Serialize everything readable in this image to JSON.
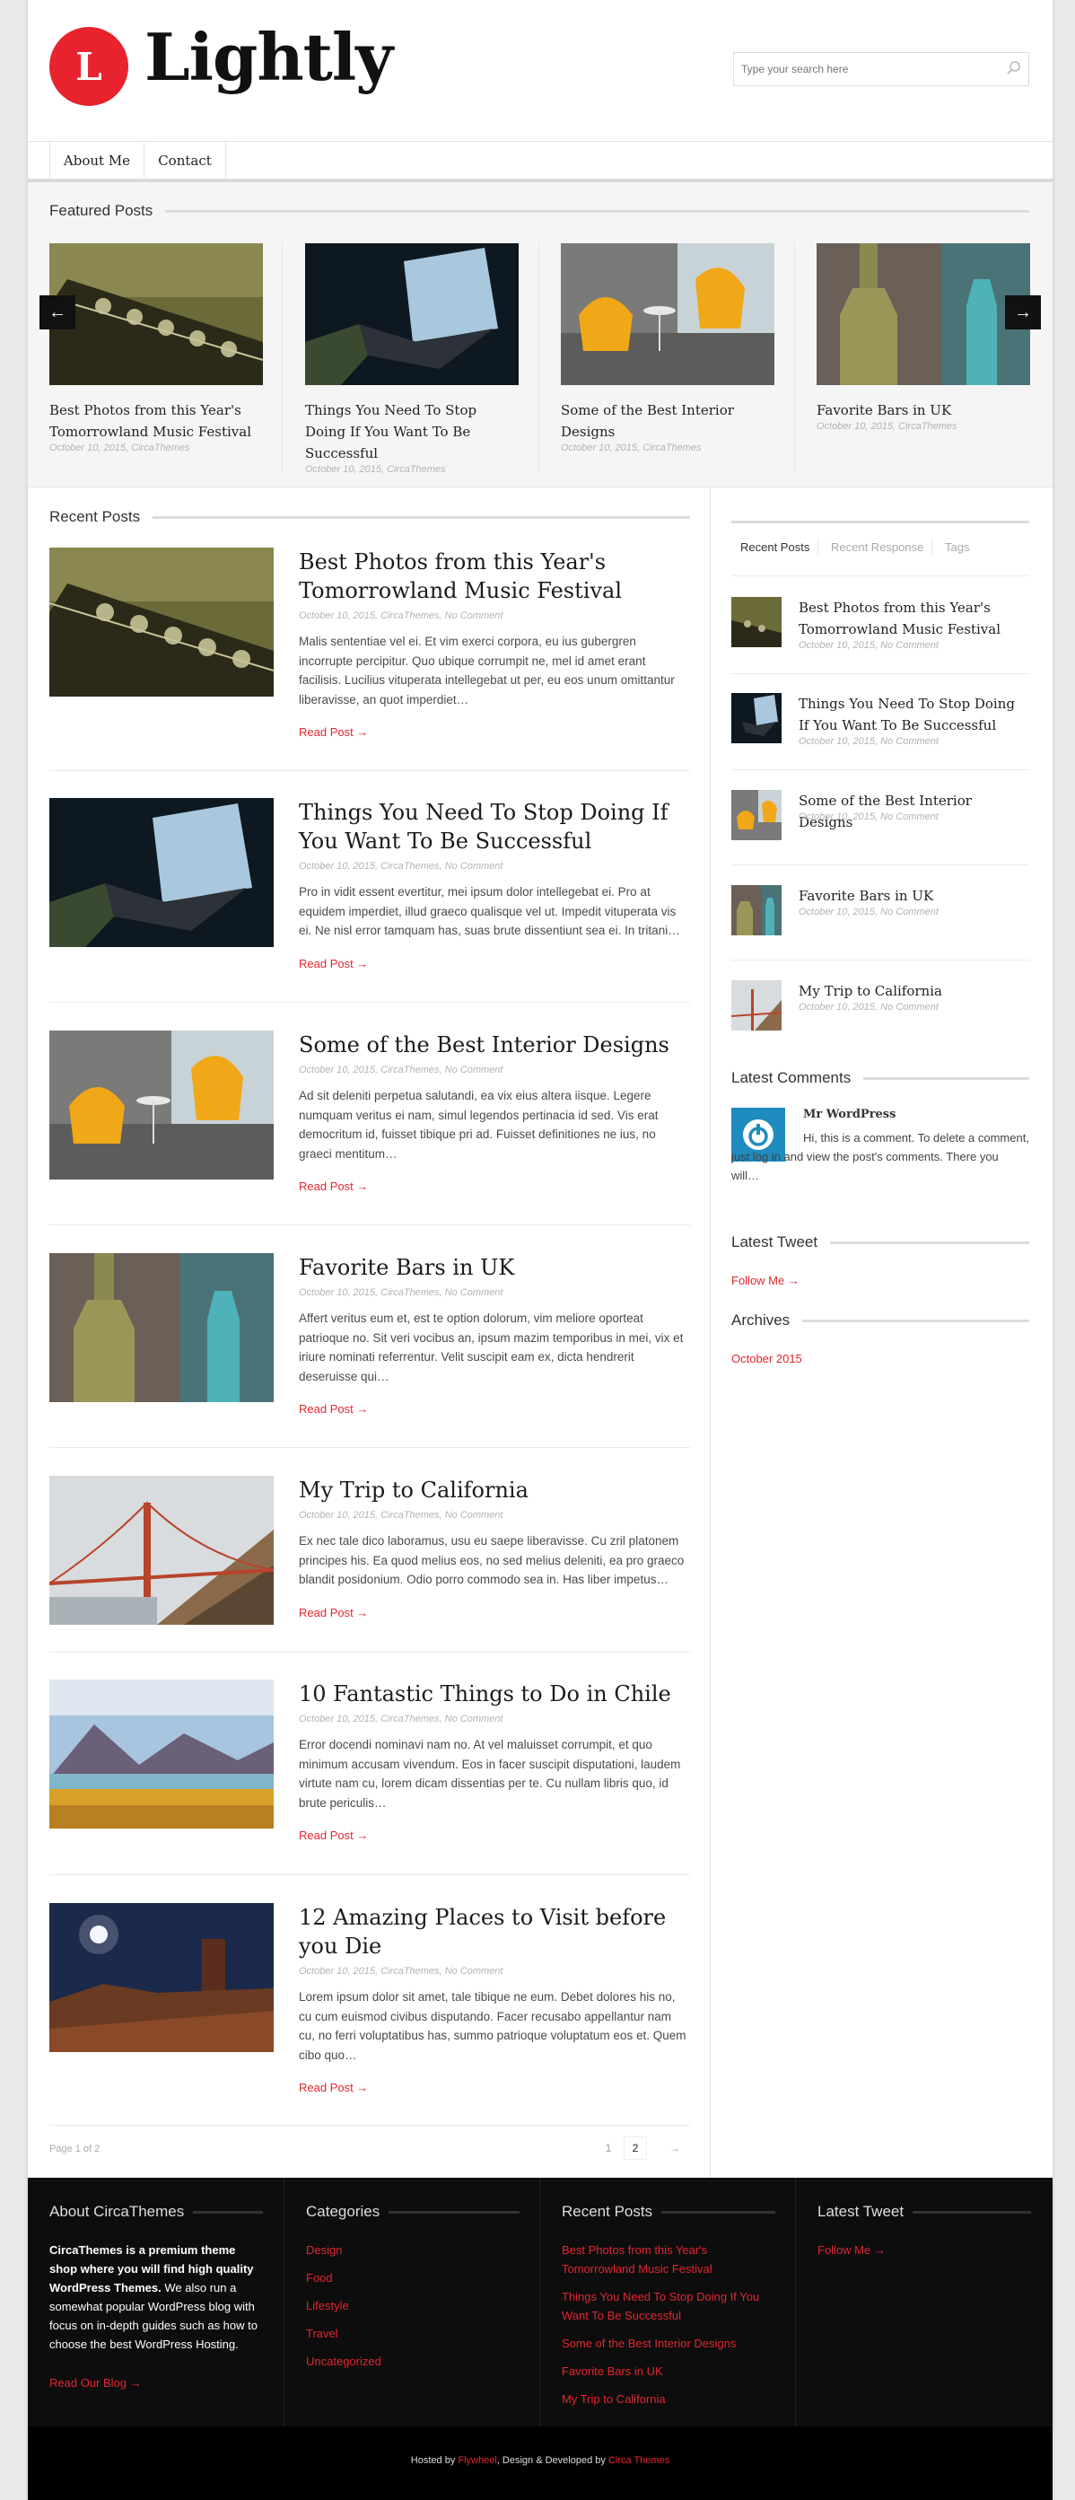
{
  "site": {
    "logo_letter": "L",
    "name": "Lightly",
    "accent": "#e8232e"
  },
  "search": {
    "placeholder": "Type your search here"
  },
  "nav": {
    "items": [
      "About Me",
      "Contact"
    ]
  },
  "featured": {
    "heading": "Featured Posts",
    "items": [
      {
        "title": "Best Photos from this Year's Tomorrowland Music Festival",
        "date": "October 10, 2015",
        "author": "CircaThemes"
      },
      {
        "title": "Things You Need To Stop Doing If You Want To Be Successful",
        "date": "October 10, 2015",
        "author": "CircaThemes"
      },
      {
        "title": "Some of the Best Interior Designs",
        "date": "October 10, 2015",
        "author": "CircaThemes"
      },
      {
        "title": "Favorite Bars in UK",
        "date": "October 10, 2015",
        "author": "CircaThemes"
      }
    ],
    "prev": "←",
    "next": "→"
  },
  "recent": {
    "heading": "Recent Posts",
    "posts": [
      {
        "title": "Best Photos from this Year's Tomorrowland Music Festival",
        "date": "October 10, 2015",
        "author": "CircaThemes",
        "comments": "No Comment",
        "excerpt": "Malis sententiae vel ei. Et vim exerci corpora, eu ius gubergren incorrupte percipitur. Quo ubique corrumpit ne, mel id amet erant facilisis. Lucilius vituperata intellegebat ut per, eu eos unum omittantur liberavisse, an quot imperdiet…",
        "read_more": "Read Post →"
      },
      {
        "title": "Things You Need To Stop Doing If You Want To Be Successful",
        "date": "October 10, 2015",
        "author": "CircaThemes",
        "comments": "No Comment",
        "excerpt": "Pro in vidit essent evertitur, mei ipsum dolor intellegebat ei. Pro at equidem imperdiet, illud graeco qualisque vel ut. Impedit vituperata vis ei. Ne nisl error tamquam has, suas brute dissentiunt sea ei. In tritani…",
        "read_more": "Read Post →"
      },
      {
        "title": "Some of the Best Interior Designs",
        "date": "October 10, 2015",
        "author": "CircaThemes",
        "comments": "No Comment",
        "excerpt": "Ad sit deleniti perpetua salutandi, ea vix eius altera iisque. Legere numquam veritus ei nam, simul legendos pertinacia id sed. Vis erat democritum id, fuisset tibique pri ad. Fuisset definitiones ne ius, no graeci mentitum…",
        "read_more": "Read Post →"
      },
      {
        "title": "Favorite Bars in UK",
        "date": "October 10, 2015",
        "author": "CircaThemes",
        "comments": "No Comment",
        "excerpt": "Affert veritus eum et, est te option dolorum, vim meliore oporteat patrioque no. Sit veri vocibus an, ipsum mazim temporibus in mei, vix et iriure nominati referrentur. Velit suscipit eam ex, dicta hendrerit deseruisse qui…",
        "read_more": "Read Post →"
      },
      {
        "title": "My Trip to California",
        "date": "October 10, 2015",
        "author": "CircaThemes",
        "comments": "No Comment",
        "excerpt": "Ex nec tale dico laboramus, usu eu saepe liberavisse. Cu zril platonem principes his. Ea quod melius eos, no sed melius deleniti, ea pro graeco blandit posidonium. Odio porro commodo sea in. Has liber impetus…",
        "read_more": "Read Post →"
      },
      {
        "title": "10 Fantastic Things to Do in Chile",
        "date": "October 10, 2015",
        "author": "CircaThemes",
        "comments": "No Comment",
        "excerpt": "Error docendi nominavi nam no. At vel maluisset corrumpit, et quo minimum accusam vivendum. Eos in facer suscipit disputationi, laudem virtute nam cu, lorem dicam dissentias per te. Cu nullam libris quo, id brute periculis…",
        "read_more": "Read Post →"
      },
      {
        "title": "12 Amazing Places to Visit before you Die",
        "date": "October 10, 2015",
        "author": "CircaThemes",
        "comments": "No Comment",
        "excerpt": "Lorem ipsum dolor sit amet, tale tibique ne eum. Debet dolores his no, cu cum euismod civibus disputando. Facer recusabo appellantur nam cu, no ferri voluptatibus has, summo patrioque voluptatum eos et. Quem cibo quo…",
        "read_more": "Read Post →"
      }
    ],
    "pagination": {
      "label": "Page 1 of 2",
      "pages": [
        "1",
        "2"
      ],
      "next": "→"
    }
  },
  "sidebar": {
    "tabs": [
      "Recent Posts",
      "Recent Response",
      "Tags"
    ],
    "items": [
      {
        "title": "Best Photos from this Year's Tomorrowland Music Festival",
        "date": "October 10, 2015",
        "comments": "No Comment"
      },
      {
        "title": "Things You Need To Stop Doing If You Want To Be Successful",
        "date": "October 10, 2015",
        "comments": "No Comment"
      },
      {
        "title": "Some of the Best Interior Designs",
        "date": "October 10, 2015",
        "comments": "No Comment"
      },
      {
        "title": "Favorite Bars in UK",
        "date": "October 10, 2015",
        "comments": "No Comment"
      },
      {
        "title": "My Trip to California",
        "date": "October 10, 2015",
        "comments": "No Comment"
      }
    ],
    "latest_comments": {
      "heading": "Latest Comments",
      "author": "Mr WordPress",
      "text": "Hi, this is a comment. To delete a comment, just log in and view the post's comments. There you will…"
    },
    "latest_tweet": {
      "heading": "Latest Tweet",
      "link": "Follow Me →"
    },
    "archives": {
      "heading": "Archives",
      "link": "October 2015"
    }
  },
  "footer": {
    "about": {
      "heading": "About CircaThemes",
      "text_bold": "CircaThemes is a premium theme shop where you will find high quality WordPress Themes.",
      "text": " We also run a somewhat popular WordPress blog with focus on in-depth guides such as how to choose the best WordPress Hosting.",
      "link": "Read Our Blog →"
    },
    "categories": {
      "heading": "Categories",
      "items": [
        "Design",
        "Food",
        "Lifestyle",
        "Travel",
        "Uncategorized"
      ]
    },
    "recent_posts": {
      "heading": "Recent Posts",
      "items": [
        "Best Photos from this Year's Tomorrowland Music Festival",
        "Things You Need To Stop Doing If You Want To Be Successful",
        "Some of the Best Interior Designs",
        "Favorite Bars in UK",
        "My Trip to California"
      ]
    },
    "tweet": {
      "heading": "Latest Tweet",
      "link": "Follow Me →"
    },
    "credits": {
      "hosted_by": "Hosted by",
      "host": "Flywheel",
      "design_by": ", Design & Developed by",
      "designer": "Circa Themes"
    }
  }
}
